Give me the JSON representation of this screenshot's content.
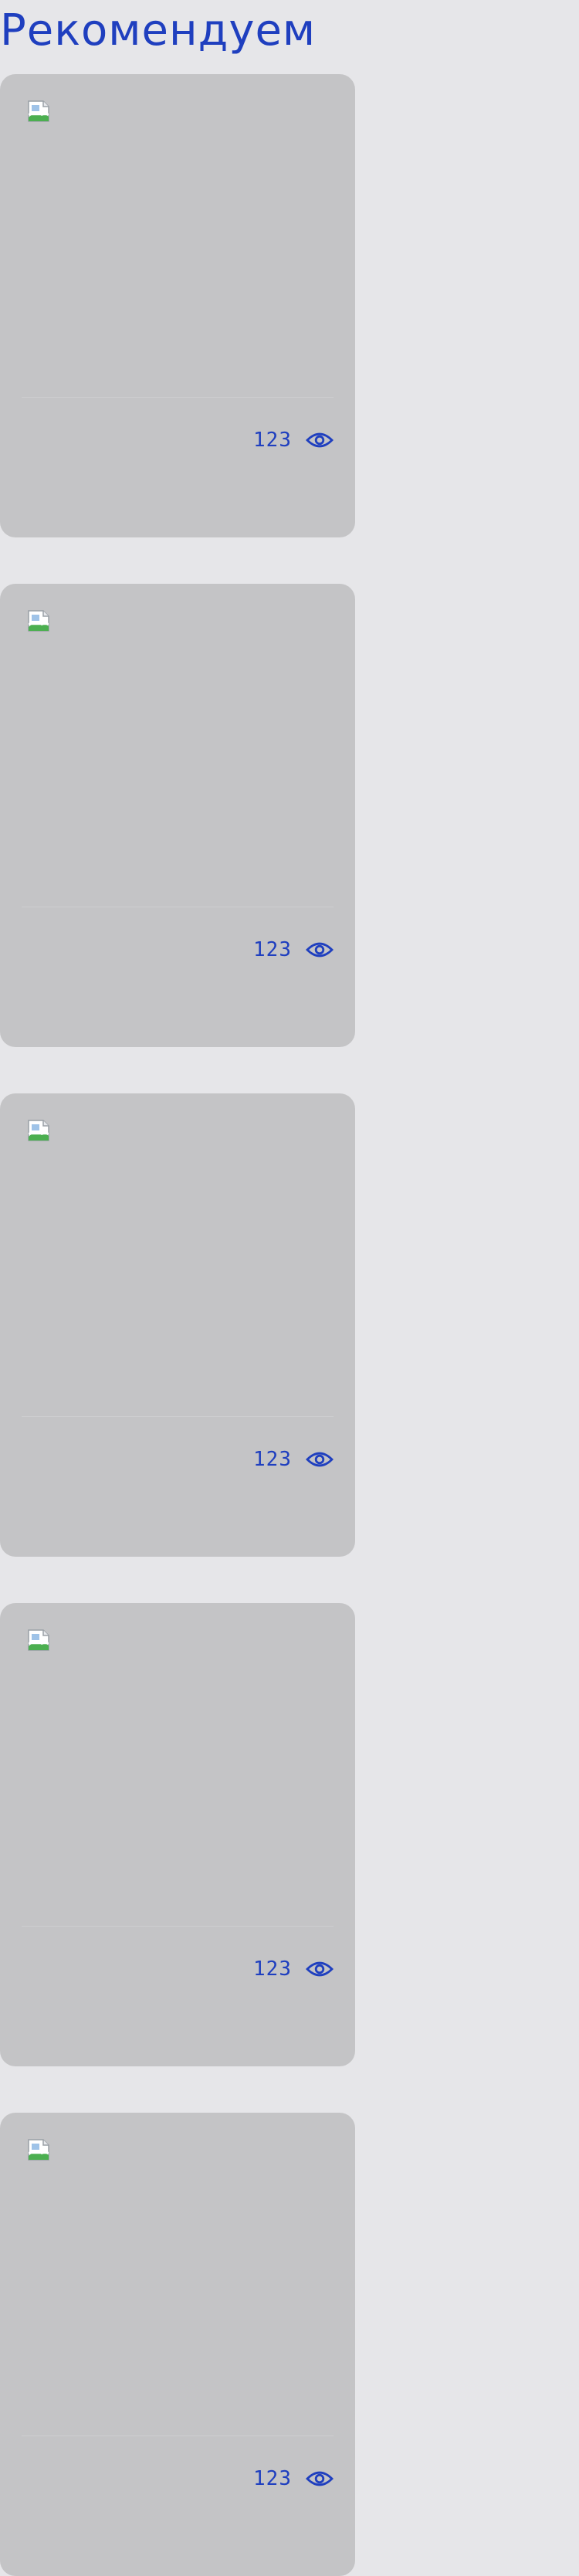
{
  "section": {
    "title": "Рекомендуем"
  },
  "colors": {
    "accent": "#1f3fbf",
    "card_bg": "#c4c4c6",
    "page_bg": "#e6e6e9"
  },
  "cards": [
    {
      "image_icon": "broken-image-icon",
      "views": "123",
      "views_icon": "eye-icon"
    },
    {
      "image_icon": "broken-image-icon",
      "views": "123",
      "views_icon": "eye-icon"
    },
    {
      "image_icon": "broken-image-icon",
      "views": "123",
      "views_icon": "eye-icon"
    },
    {
      "image_icon": "broken-image-icon",
      "views": "123",
      "views_icon": "eye-icon"
    },
    {
      "image_icon": "broken-image-icon",
      "views": "123",
      "views_icon": "eye-icon"
    }
  ]
}
